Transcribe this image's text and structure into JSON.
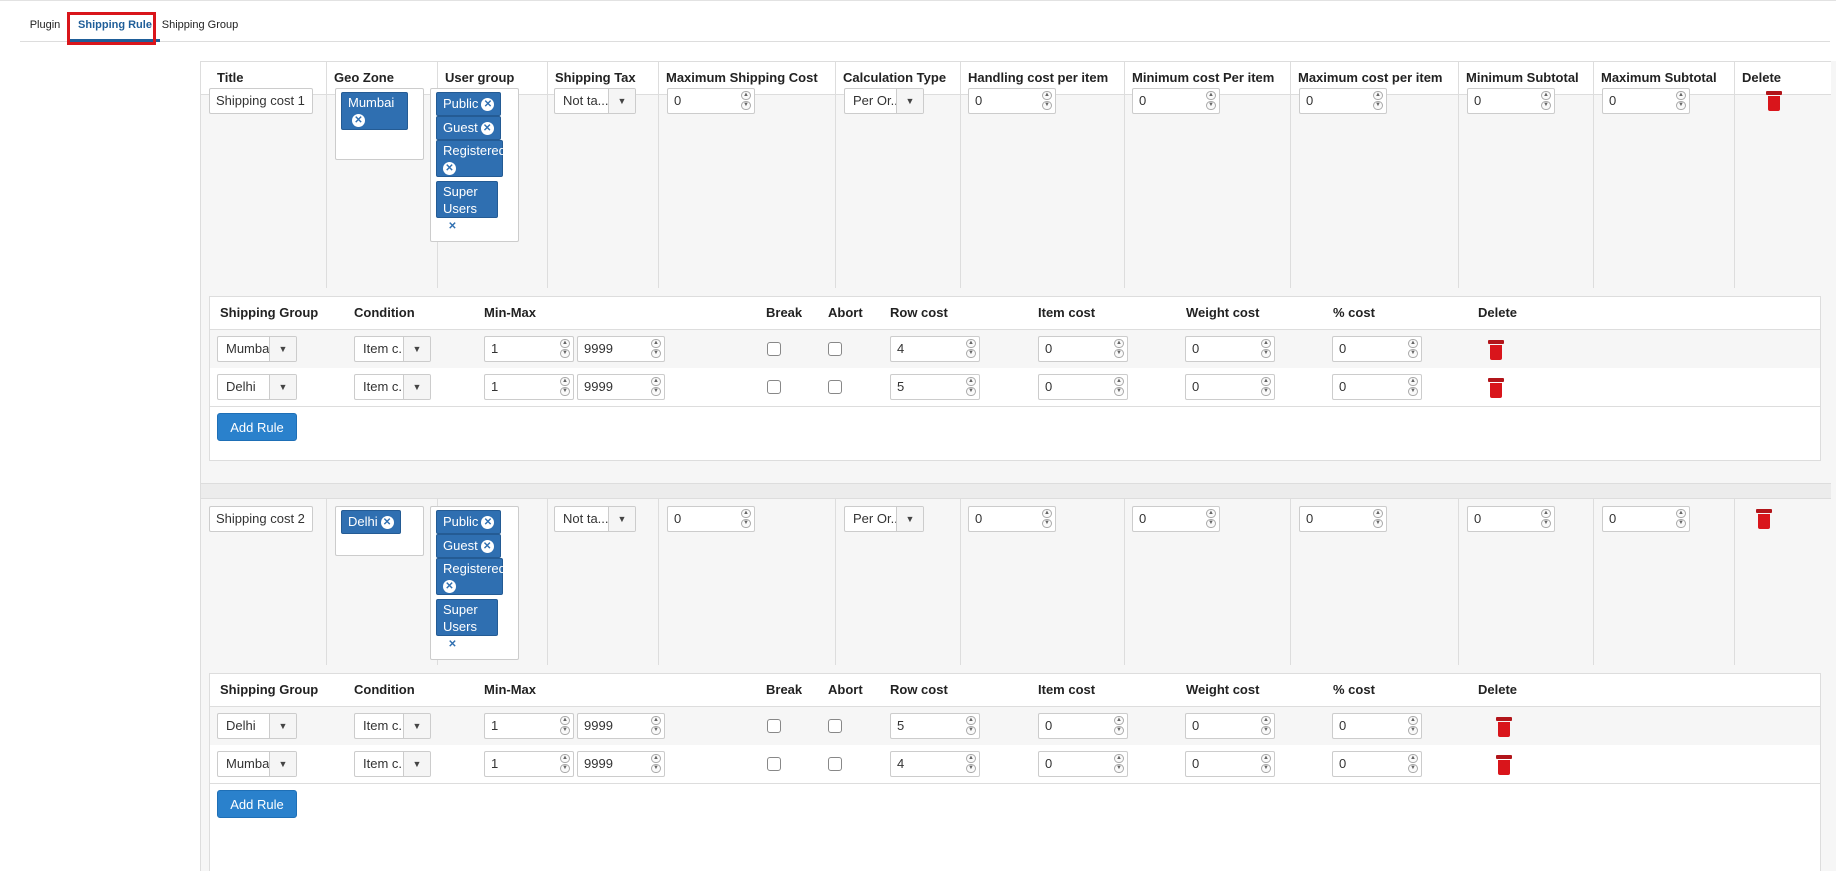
{
  "tabs": [
    {
      "label": "Plugin"
    },
    {
      "label": "Shipping Rule"
    },
    {
      "label": "Shipping Group"
    }
  ],
  "table_headers": [
    "Title",
    "Geo Zone",
    "User group",
    "Shipping Tax",
    "Maximum Shipping Cost",
    "Calculation Type",
    "Handling cost per item",
    "Minimum cost Per item",
    "Maximum cost per item",
    "Minimum Subtotal",
    "Maximum Subtotal",
    "Delete"
  ],
  "inner_headers": [
    "Shipping Group",
    "Condition",
    "Min-Max",
    "Break",
    "Abort",
    "Row cost",
    "Item cost",
    "Weight cost",
    "% cost",
    "Delete"
  ],
  "add_rule_label": "Add Rule",
  "user_groups": [
    "Public",
    "Guest",
    "Registered",
    "Super Users"
  ],
  "shipping_costs": [
    {
      "title": "Shipping cost 1",
      "geo_zone": "Mumbai",
      "shipping_tax": "Not ta...",
      "max_shipping_cost": "0",
      "calculation_type": "Per Or...",
      "handling_cost": "0",
      "min_cost_per_item": "0",
      "max_cost_per_item": "0",
      "min_subtotal": "0",
      "max_subtotal": "0",
      "rules": [
        {
          "group": "Mumbai",
          "condition": "Item c...",
          "min": "1",
          "max": "9999",
          "row_cost": "4",
          "item_cost": "0",
          "weight_cost": "0",
          "pct_cost": "0"
        },
        {
          "group": "Delhi",
          "condition": "Item c...",
          "min": "1",
          "max": "9999",
          "row_cost": "5",
          "item_cost": "0",
          "weight_cost": "0",
          "pct_cost": "0"
        }
      ]
    },
    {
      "title": "Shipping cost 2",
      "geo_zone": "Delhi",
      "shipping_tax": "Not ta...",
      "max_shipping_cost": "0",
      "calculation_type": "Per Or...",
      "handling_cost": "0",
      "min_cost_per_item": "0",
      "max_cost_per_item": "0",
      "min_subtotal": "0",
      "max_subtotal": "0",
      "rules": [
        {
          "group": "Delhi",
          "condition": "Item c...",
          "min": "1",
          "max": "9999",
          "row_cost": "5",
          "item_cost": "0",
          "weight_cost": "0",
          "pct_cost": "0"
        },
        {
          "group": "Mumbai",
          "condition": "Item c...",
          "min": "1",
          "max": "9999",
          "row_cost": "4",
          "item_cost": "0",
          "weight_cost": "0",
          "pct_cost": "0"
        }
      ]
    }
  ]
}
